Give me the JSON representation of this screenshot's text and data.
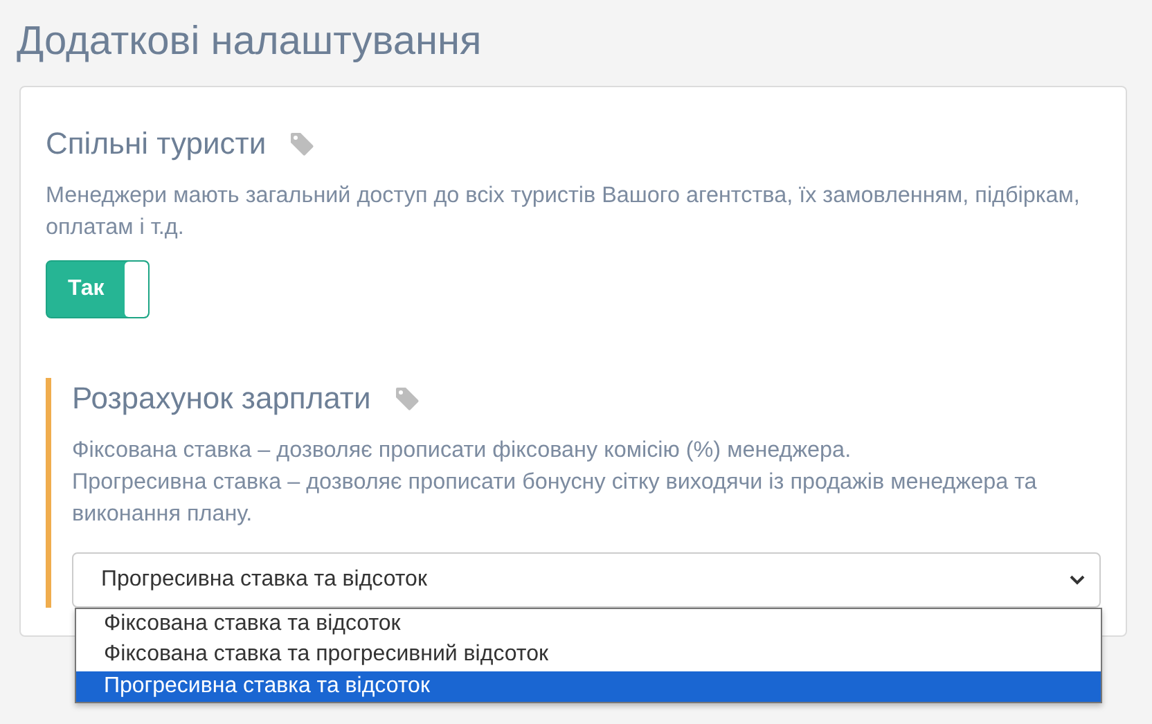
{
  "page_title": "Додаткові налаштування",
  "sections": [
    {
      "kind": "toggle",
      "title": "Спільні туристи",
      "highlighted": false,
      "description": [
        "Менеджери мають загальний доступ до всіх туристів Вашого агентства, їх замовленням, підбіркам, оплатам і т.д."
      ],
      "toggle": {
        "label": "Так",
        "on": true
      }
    },
    {
      "kind": "select",
      "title": "Розрахунок зарплати",
      "highlighted": true,
      "description": [
        "Фіксована ставка – дозволяє прописати фіксовану комісію (%) менеджера.",
        "Прогресивна ставка – дозволяє прописати бонусну сітку виходячи із продажів менеджера та виконання плану."
      ],
      "select": {
        "value": "Прогресивна ставка та відсоток",
        "expanded": true,
        "options": [
          {
            "label": "Фіксована ставка та відсоток",
            "selected": false
          },
          {
            "label": "Фіксована ставка та прогресивний відсоток",
            "selected": false
          },
          {
            "label": "Прогресивна ставка та відсоток",
            "selected": true
          }
        ]
      }
    }
  ]
}
